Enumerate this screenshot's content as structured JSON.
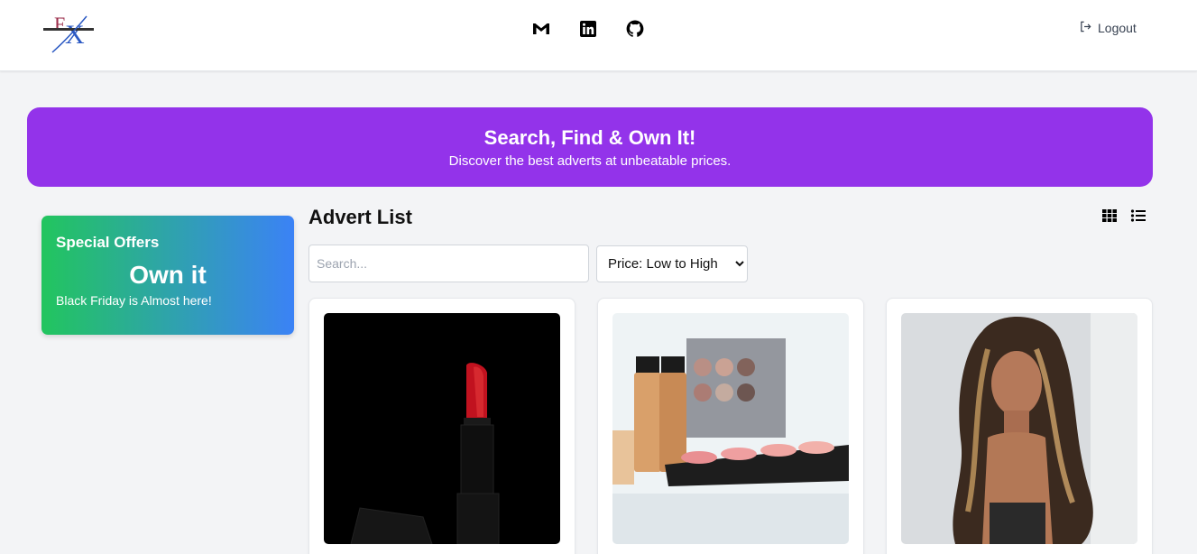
{
  "nav": {
    "logo_alt": "FX",
    "social": [
      {
        "name": "gmail-icon"
      },
      {
        "name": "linkedin-icon"
      },
      {
        "name": "github-icon"
      }
    ],
    "logout_label": "Logout"
  },
  "hero": {
    "title": "Search, Find & Own It!",
    "subtitle": "Discover the best adverts at unbeatable prices.",
    "color": "#9333ea"
  },
  "offer": {
    "title": "Special Offers",
    "headline": "Own it",
    "subtitle": "Black Friday is Almost here!"
  },
  "adverts": {
    "title": "Advert List",
    "search_placeholder": "Search...",
    "sort_selected": "Price: Low to High",
    "sort_options": [
      "Price: Low to High"
    ],
    "cards": [
      {
        "image": "lipstick-image"
      },
      {
        "image": "makeup-palette-image"
      },
      {
        "image": "wig-model-image"
      }
    ]
  }
}
